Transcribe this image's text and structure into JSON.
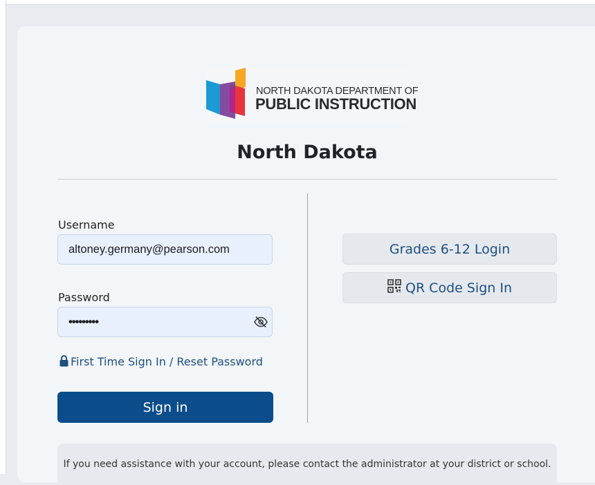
{
  "logo": {
    "line1": "North Dakota Department of",
    "line2": "Public Instruction"
  },
  "page_title": "North Dakota",
  "form": {
    "username_label": "Username",
    "username_value": "altoney.germany@pearson.com",
    "password_label": "Password",
    "password_value": "•••••••••",
    "reset_link": "First Time Sign In / Reset Password",
    "signin_label": "Sign in"
  },
  "alt_login": {
    "grades_label": "Grades 6-12 Login",
    "qr_label": "QR Code Sign In"
  },
  "help_text": "If you need assistance with your account, please contact the administrator at your district or school.",
  "icons": [
    "show-password-eye-icon",
    "lock-icon",
    "qr-code-icon"
  ],
  "colors": {
    "primary": "#0b4d8a",
    "link": "#1d4f7f",
    "field_bg": "#e8f0fd",
    "card_bg": "#f3f6f9",
    "logo_orange": "#f7a823",
    "logo_blue": "#1c9ad6",
    "logo_purple": "#7a3d96",
    "logo_red": "#e8343c"
  }
}
